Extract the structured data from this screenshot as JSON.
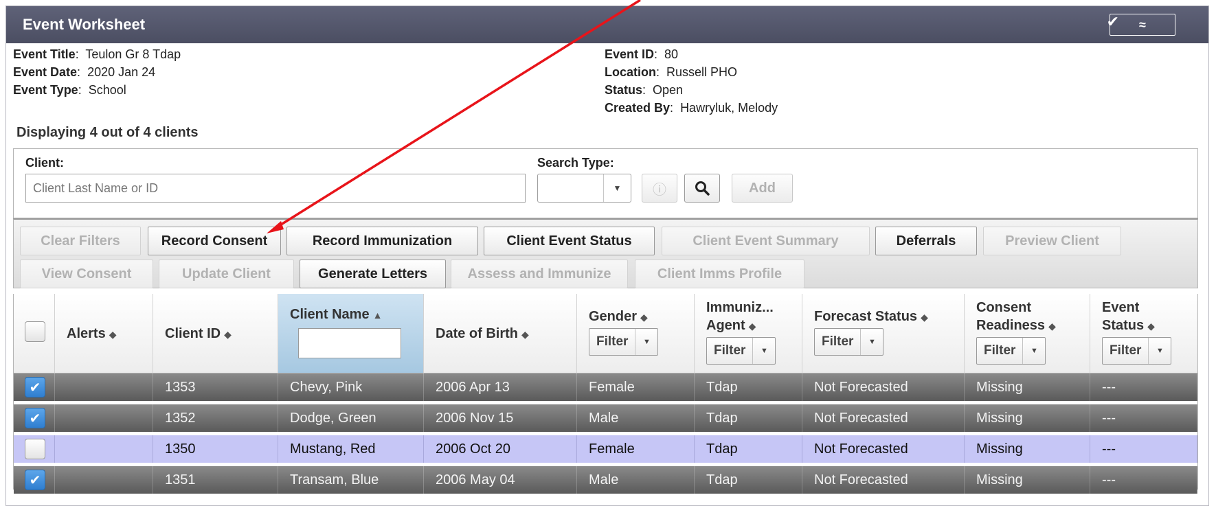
{
  "header": {
    "title": "Event Worksheet",
    "check_icon": "checkmark-icon",
    "collapse_icon": "double-chevron-up-icon"
  },
  "event": {
    "left": [
      {
        "label": "Event Title",
        "value": "Teulon Gr 8 Tdap"
      },
      {
        "label": "Event Date",
        "value": "2020 Jan 24"
      },
      {
        "label": "Event Type",
        "value": "School"
      }
    ],
    "right": [
      {
        "label": "Event ID",
        "value": "80"
      },
      {
        "label": "Location",
        "value": "Russell PHO"
      },
      {
        "label": "Status",
        "value": "Open"
      },
      {
        "label": "Created By",
        "value": "Hawryluk, Melody"
      }
    ]
  },
  "displaying": "Displaying 4 out of 4 clients",
  "search": {
    "client_label": "Client:",
    "client_placeholder": "Client Last Name or ID",
    "client_value": "",
    "type_label": "Search Type:",
    "type_value": "",
    "info_icon": "info-icon",
    "search_icon": "search-icon",
    "add_label": "Add"
  },
  "toolbar": {
    "row1": [
      {
        "label": "Clear Filters",
        "enabled": false
      },
      {
        "label": "Record Consent",
        "enabled": true
      },
      {
        "label": "Record Immunization",
        "enabled": true
      },
      {
        "label": "Client Event Status",
        "enabled": true
      },
      {
        "label": "Client Event Summary",
        "enabled": false
      },
      {
        "label": "Deferrals",
        "enabled": true
      },
      {
        "label": "Preview Client",
        "enabled": false
      }
    ],
    "row2": [
      {
        "label": "View Consent",
        "enabled": false
      },
      {
        "label": "Update Client",
        "enabled": false
      },
      {
        "label": "Generate Letters",
        "enabled": true
      },
      {
        "label": "Assess and Immunize",
        "enabled": false
      },
      {
        "label": "Client Imms Profile",
        "enabled": false
      }
    ]
  },
  "grid": {
    "columns": [
      {
        "line1": "",
        "line2": ""
      },
      {
        "line1": "Alerts",
        "line2": ""
      },
      {
        "line1": "Client ID",
        "line2": ""
      },
      {
        "line1": "Client Name",
        "line2": ""
      },
      {
        "line1": "Date of Birth",
        "line2": ""
      },
      {
        "line1": "Gender",
        "line2": ""
      },
      {
        "line1": "Immuniz...",
        "line2": "Agent"
      },
      {
        "line1": "Forecast Status",
        "line2": ""
      },
      {
        "line1": "Consent",
        "line2": "Readiness"
      },
      {
        "line1": "Event",
        "line2": "Status"
      }
    ],
    "filter_label": "Filter",
    "sorted_column": "Client Name",
    "sort_direction": "ascending",
    "rows": [
      {
        "checked": true,
        "alerts": "",
        "client_id": "1353",
        "client_name": "Chevy, Pink",
        "dob": "2006 Apr 13",
        "gender": "Female",
        "agent": "Tdap",
        "forecast": "Not Forecasted",
        "consent": "Missing",
        "event_status": "---",
        "style": "dark"
      },
      {
        "checked": true,
        "alerts": "",
        "client_id": "1352",
        "client_name": "Dodge, Green",
        "dob": "2006 Nov 15",
        "gender": "Male",
        "agent": "Tdap",
        "forecast": "Not Forecasted",
        "consent": "Missing",
        "event_status": "---",
        "style": "dark"
      },
      {
        "checked": false,
        "alerts": "",
        "client_id": "1350",
        "client_name": "Mustang, Red",
        "dob": "2006 Oct 20",
        "gender": "Female",
        "agent": "Tdap",
        "forecast": "Not Forecasted",
        "consent": "Missing",
        "event_status": "---",
        "style": "light"
      },
      {
        "checked": true,
        "alerts": "",
        "client_id": "1351",
        "client_name": "Transam, Blue",
        "dob": "2006 May 04",
        "gender": "Male",
        "agent": "Tdap",
        "forecast": "Not Forecasted",
        "consent": "Missing",
        "event_status": "---",
        "style": "dark"
      }
    ]
  },
  "annotation": {
    "color": "#e8141a",
    "points_to": "Record Consent"
  }
}
